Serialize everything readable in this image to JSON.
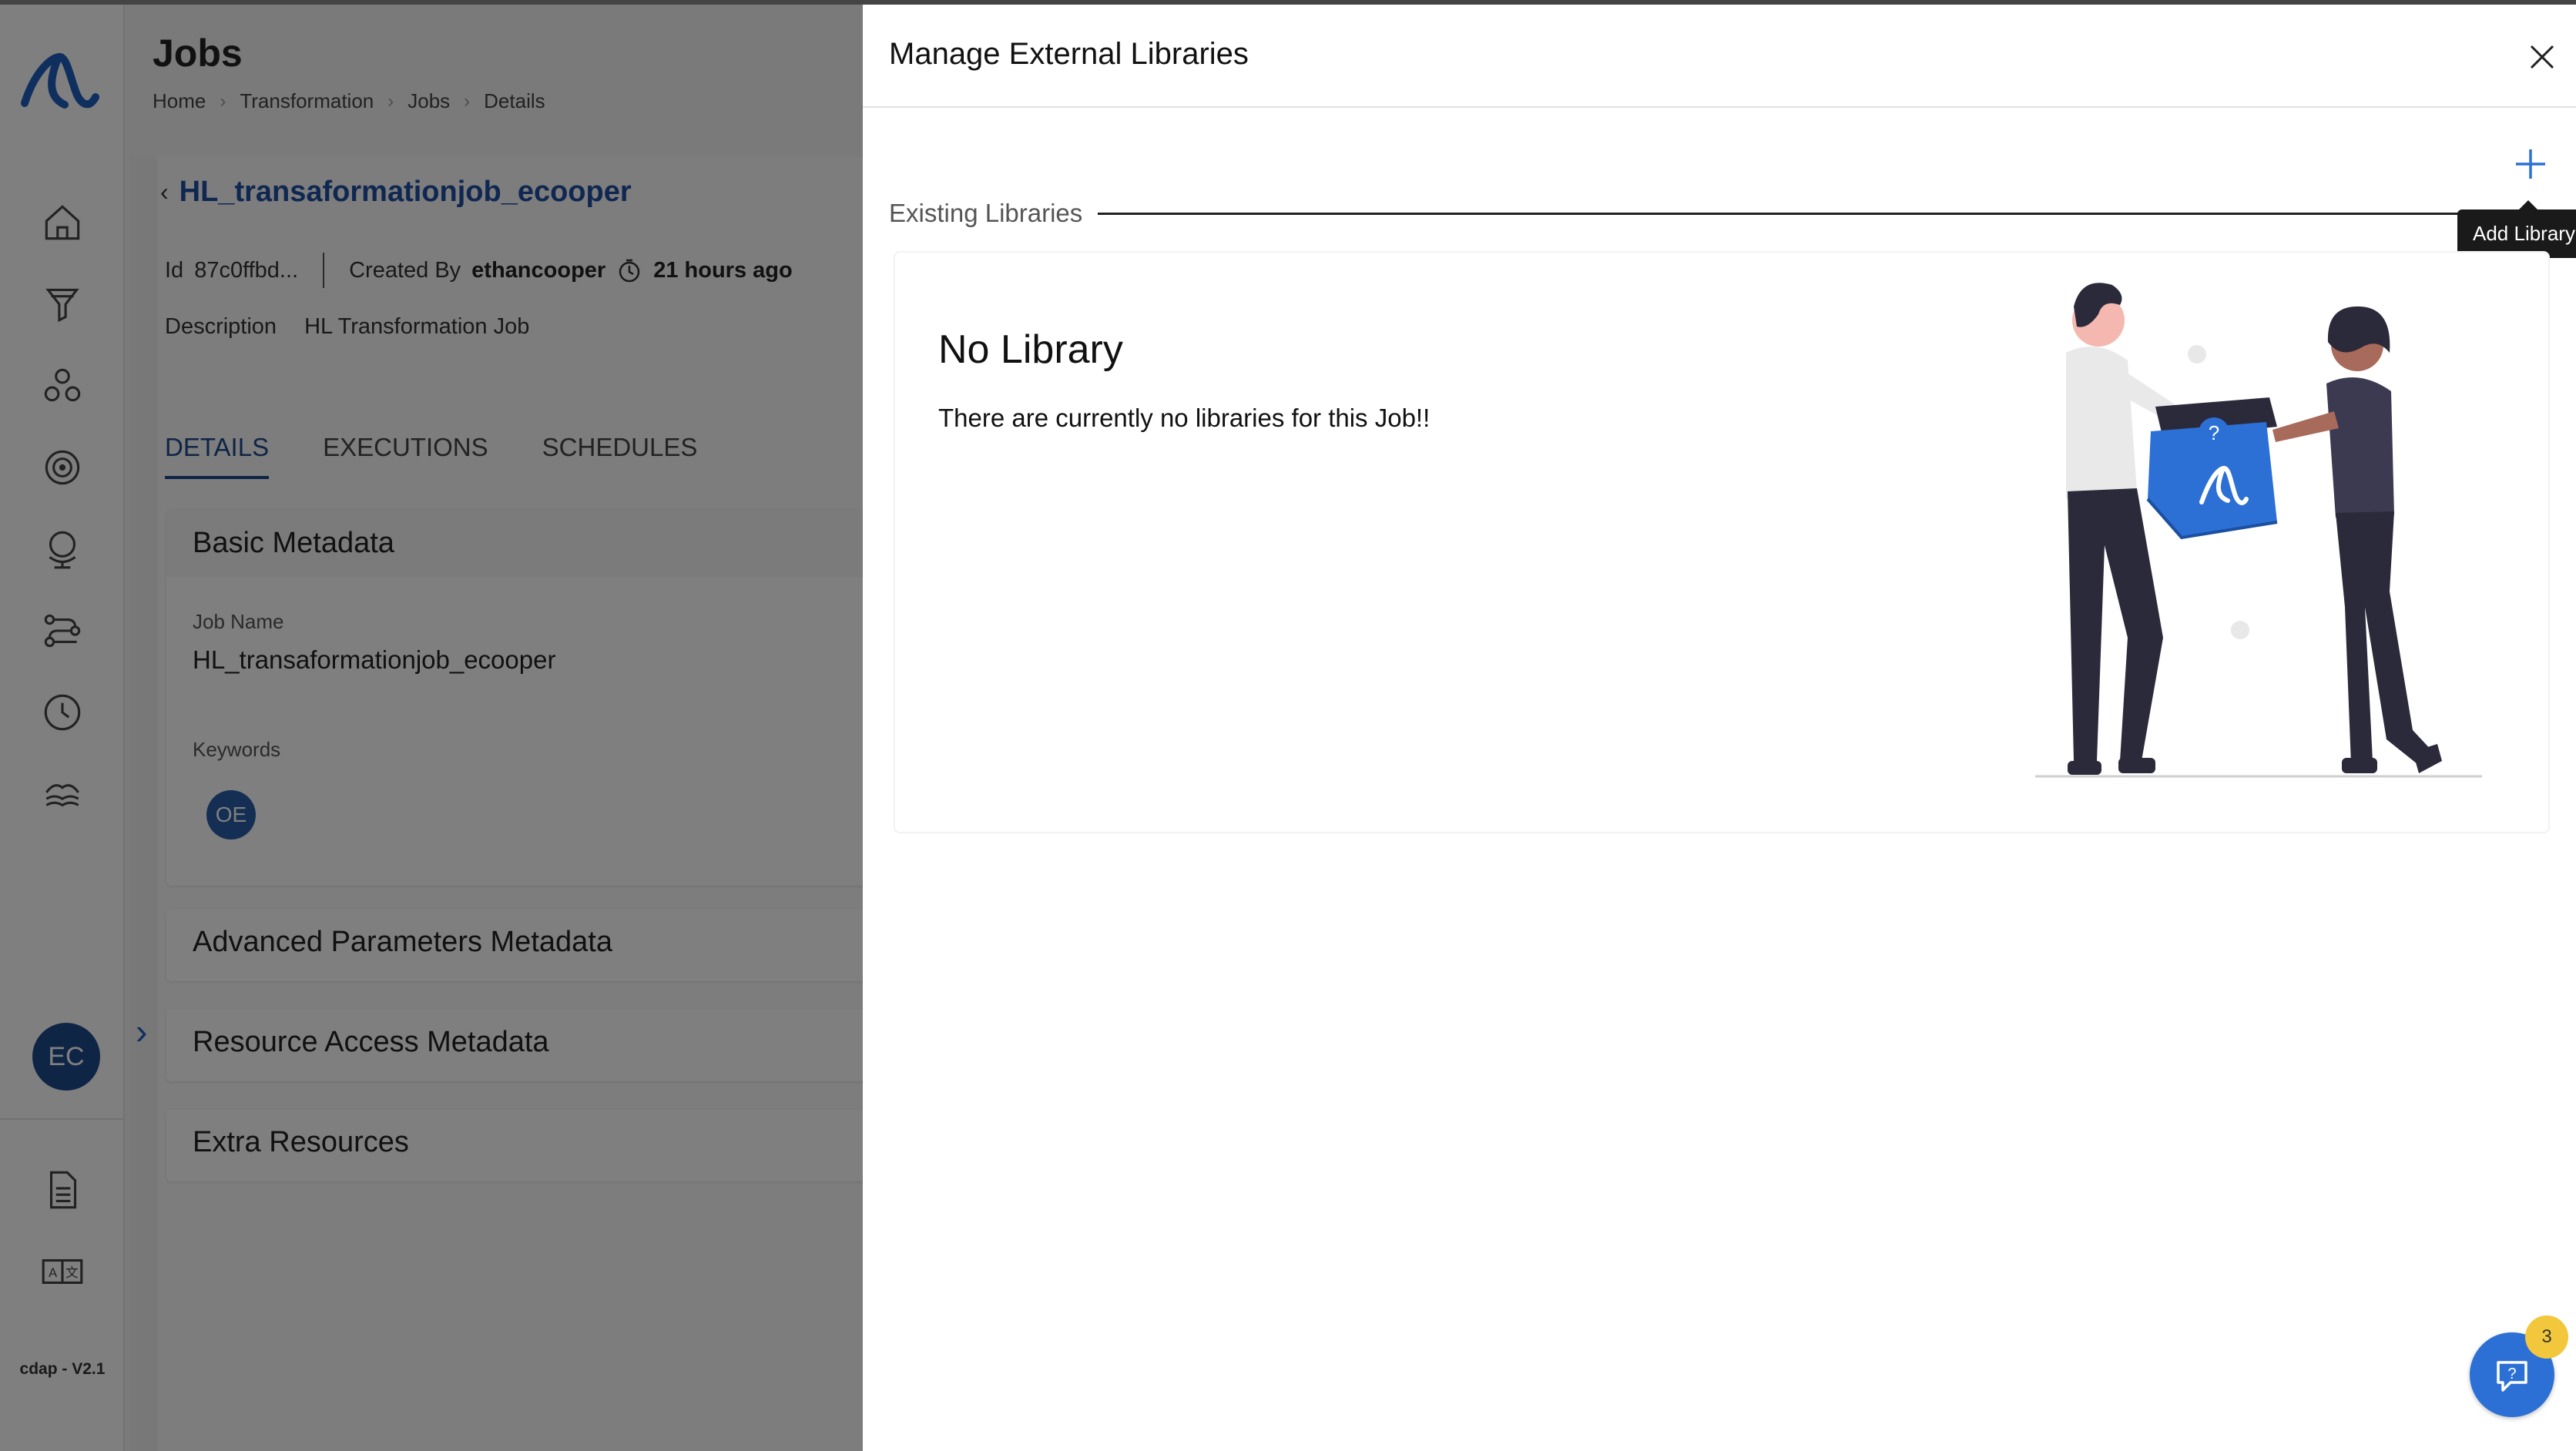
{
  "app": {
    "version": "cdap - V2.1",
    "user_initials": "EC"
  },
  "sidebar": {
    "items": [
      {
        "icon": "home-icon"
      },
      {
        "icon": "funnel-icon"
      },
      {
        "icon": "cluster-icon"
      },
      {
        "icon": "target-icon"
      },
      {
        "icon": "globe-stand-icon"
      },
      {
        "icon": "workflow-icon"
      },
      {
        "icon": "clock-icon"
      },
      {
        "icon": "data-lake-icon"
      }
    ],
    "bottom_items": [
      {
        "icon": "document-icon"
      },
      {
        "icon": "translate-icon"
      }
    ]
  },
  "header": {
    "title": "Jobs",
    "breadcrumb": [
      "Home",
      "Transformation",
      "Jobs",
      "Details"
    ]
  },
  "job": {
    "name": "HL_transaformationjob_ecooper",
    "id_label": "Id",
    "id_value": "87c0ffbd...",
    "created_by_label": "Created By",
    "created_by_value": "ethancooper",
    "created_time": "21 hours ago",
    "description_label": "Description",
    "description_value": "HL Transformation Job"
  },
  "tabs": [
    "DETAILS",
    "EXECUTIONS",
    "SCHEDULES"
  ],
  "sections": {
    "basic": {
      "title": "Basic Metadata",
      "job_name_label": "Job Name",
      "job_name_value": "HL_transaformationjob_ecooper",
      "keywords_label": "Keywords",
      "keyword_chip": "OE"
    },
    "advanced": "Advanced Parameters Metadata",
    "resource": "Resource Access Metadata",
    "extra": "Extra Resources"
  },
  "drawer": {
    "title": "Manage External Libraries",
    "existing_label": "Existing Libraries",
    "add_tooltip": "Add Library",
    "empty_title": "No Library",
    "empty_text": "There are currently no libraries for this Job!!"
  },
  "help": {
    "badge_count": "3"
  },
  "colors": {
    "brand": "#1f4a8c",
    "link": "#1f4fa3",
    "accent": "#2c70d6",
    "badge": "#f3c73c"
  }
}
